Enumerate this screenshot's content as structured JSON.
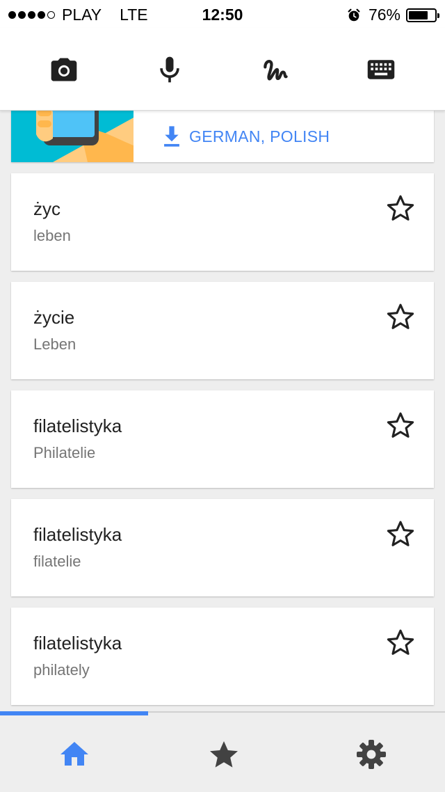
{
  "status_bar": {
    "signal_dots_filled": 4,
    "signal_dots_total": 5,
    "carrier": "PLAY",
    "network": "LTE",
    "time": "12:50",
    "alarm_icon": "alarm-clock-icon",
    "battery_percent_text": "76%",
    "battery_level": 0.76
  },
  "input_toolbar": {
    "camera_icon": "camera-icon",
    "mic_icon": "microphone-icon",
    "handwriting_icon": "handwriting-icon",
    "keyboard_icon": "keyboard-icon"
  },
  "promo": {
    "download_icon": "download-icon",
    "link_text": "GERMAN, POLISH"
  },
  "entries": [
    {
      "source": "życ",
      "target": "leben",
      "star_icon": "star-outline-icon"
    },
    {
      "source": "życie",
      "target": "Leben",
      "star_icon": "star-outline-icon"
    },
    {
      "source": "filatelistyka",
      "target": "Philatelie",
      "star_icon": "star-outline-icon"
    },
    {
      "source": "filatelistyka",
      "target": "filatelie",
      "star_icon": "star-outline-icon"
    },
    {
      "source": "filatelistyka",
      "target": "philately",
      "star_icon": "star-outline-icon"
    }
  ],
  "bottom_nav": {
    "items": [
      {
        "icon": "home-icon",
        "active": true
      },
      {
        "icon": "star-icon",
        "active": false
      },
      {
        "icon": "gear-icon",
        "active": false
      }
    ]
  },
  "colors": {
    "accent": "#4285f4",
    "text_primary": "#212121",
    "text_secondary": "#757575",
    "background": "#eeeeee",
    "icon_dark": "#212121"
  }
}
